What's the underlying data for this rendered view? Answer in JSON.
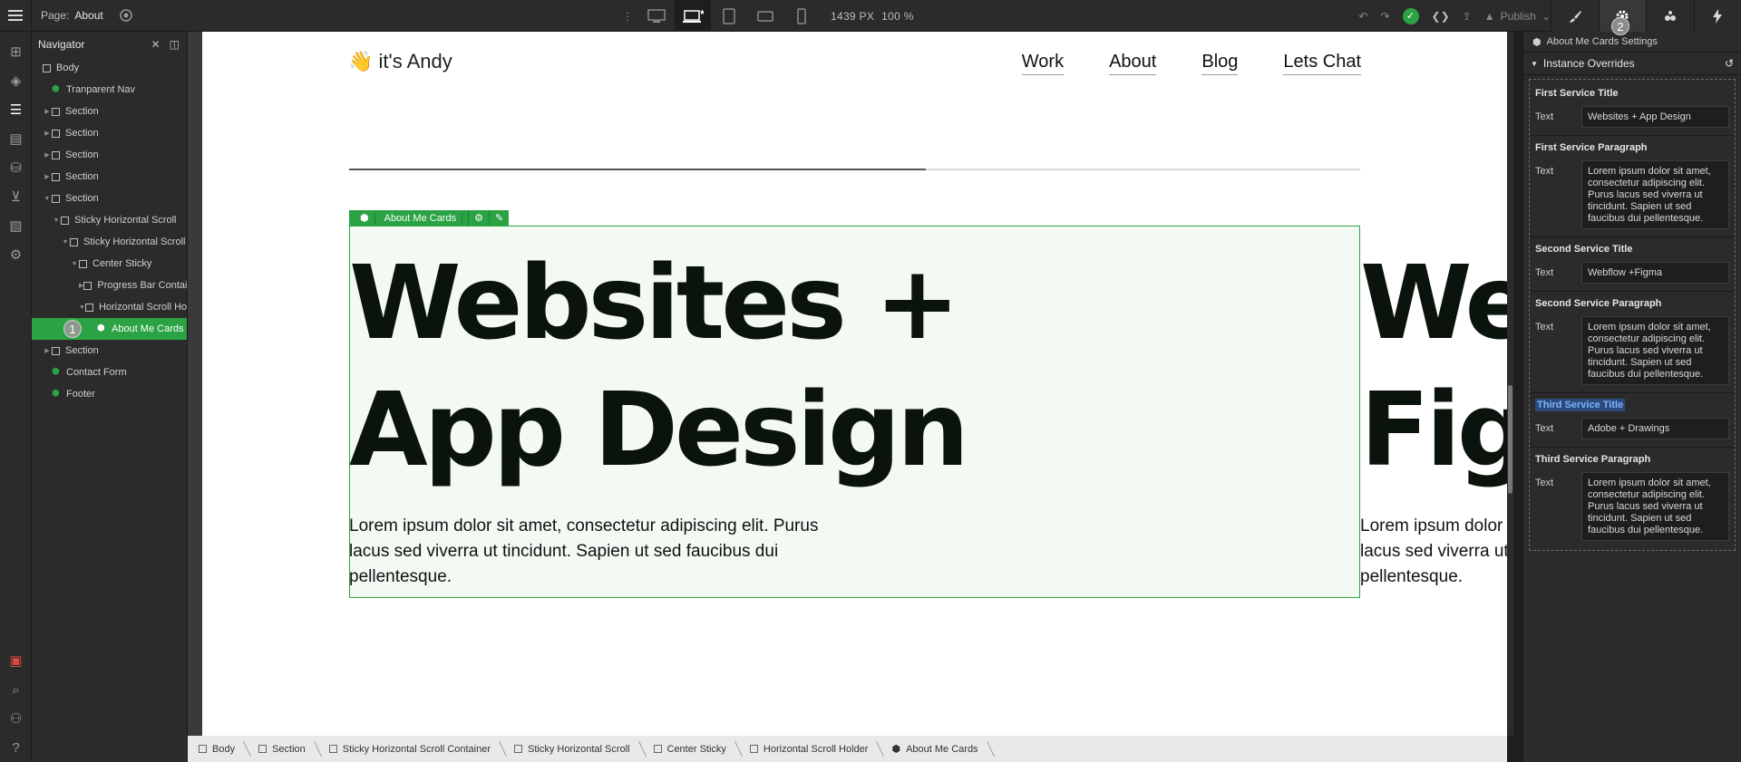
{
  "topbar": {
    "page_label": "Page:",
    "page_name": "About",
    "width_px": "1439 PX",
    "zoom": "100 %",
    "publish": "Publish"
  },
  "navigator": {
    "title": "Navigator",
    "tree": [
      {
        "label": "Body",
        "depth": 0,
        "kind": "box",
        "caret": ""
      },
      {
        "label": "Tranparent Nav",
        "depth": 1,
        "kind": "comp",
        "caret": ""
      },
      {
        "label": "Section",
        "depth": 1,
        "kind": "box",
        "caret": "▶"
      },
      {
        "label": "Section",
        "depth": 1,
        "kind": "box",
        "caret": "▶"
      },
      {
        "label": "Section",
        "depth": 1,
        "kind": "box",
        "caret": "▶"
      },
      {
        "label": "Section",
        "depth": 1,
        "kind": "box",
        "caret": "▶"
      },
      {
        "label": "Section",
        "depth": 1,
        "kind": "box",
        "caret": "▼"
      },
      {
        "label": "Sticky Horizontal Scroll",
        "depth": 2,
        "kind": "box",
        "caret": "▼"
      },
      {
        "label": "Sticky Horizontal Scroll",
        "depth": 3,
        "kind": "box",
        "caret": "▼"
      },
      {
        "label": "Center Sticky",
        "depth": 4,
        "kind": "box",
        "caret": "▼"
      },
      {
        "label": "Progress Bar Container",
        "depth": 5,
        "kind": "box",
        "caret": "▶"
      },
      {
        "label": "Horizontal Scroll Holder",
        "depth": 5,
        "kind": "box",
        "caret": "▼"
      },
      {
        "label": "About Me Cards",
        "depth": 6,
        "kind": "comp",
        "caret": "",
        "selected": true
      },
      {
        "label": "Section",
        "depth": 1,
        "kind": "box",
        "caret": "▶"
      },
      {
        "label": "Contact Form",
        "depth": 1,
        "kind": "comp",
        "caret": ""
      },
      {
        "label": "Footer",
        "depth": 1,
        "kind": "comp",
        "caret": ""
      }
    ],
    "badge": "1"
  },
  "canvas": {
    "logo": "👋 it's Andy",
    "nav": [
      "Work",
      "About",
      "Blog",
      "Lets Chat"
    ],
    "progress_fraction": 0.57,
    "selection_tag": "About Me Cards",
    "card1_title": "Websites + App Design",
    "card1_para": "Lorem ipsum dolor sit amet, consectetur adipiscing elit. Purus lacus sed viverra ut tincidunt. Sapien ut sed faucibus dui pellentesque.",
    "card2_title": "Webflow + Figma",
    "card2_para": "Lorem ipsum dolor sit amet, consectetur adipiscing elit. Purus lacus sed viverra ut tincidunt. Sapien ut sed faucibus dui pellentesque."
  },
  "breadcrumb": [
    "Body",
    "Section",
    "Sticky Horizontal Scroll Container",
    "Sticky Horizontal Scroll",
    "Center Sticky",
    "Horizontal Scroll Holder",
    "About Me Cards"
  ],
  "panel": {
    "badge": "2",
    "settings_title": "About Me Cards Settings",
    "section_title": "Instance Overrides",
    "fields": [
      {
        "title": "First Service Title",
        "label": "Text",
        "value": "Websites + App Design",
        "type": "input"
      },
      {
        "title": "First Service Paragraph",
        "label": "Text",
        "value": "Lorem ipsum dolor sit amet, consectetur adipiscing elit. Purus lacus sed viverra ut tincidunt. Sapien ut sed faucibus dui pellentesque.",
        "type": "area"
      },
      {
        "title": "Second Service Title",
        "label": "Text",
        "value": "Webflow +Figma",
        "type": "input"
      },
      {
        "title": "Second Service Paragraph",
        "label": "Text",
        "value": "Lorem ipsum dolor sit amet, consectetur adipiscing elit. Purus lacus sed viverra ut tincidunt. Sapien ut sed faucibus dui pellentesque.",
        "type": "area"
      },
      {
        "title": "Third Service Title",
        "label": "Text",
        "value": "Adobe + Drawings",
        "type": "input",
        "highlight": true
      },
      {
        "title": "Third Service Paragraph",
        "label": "Text",
        "value": "Lorem ipsum dolor sit amet, consectetur adipiscing elit. Purus lacus sed viverra ut tincidunt. Sapien ut sed faucibus dui pellentesque.",
        "type": "area"
      }
    ]
  },
  "colors": {
    "accent": "#2ba344",
    "panel": "#2b2b2b",
    "canvas_bg": "#ffffff"
  }
}
